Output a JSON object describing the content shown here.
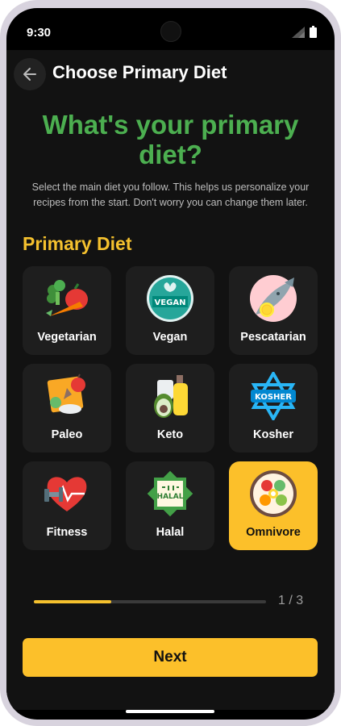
{
  "status_bar": {
    "time": "9:30",
    "icons": [
      "signal-icon",
      "battery-icon"
    ]
  },
  "header": {
    "title": "Choose Primary Diet",
    "back_icon": "arrow-left-icon"
  },
  "question": "What's your primary diet?",
  "subtitle": "Select the main diet you follow. This helps us personalize your recipes from the start. Don't worry you can change them later.",
  "section_title": "Primary Diet",
  "diets": [
    {
      "label": "Vegetarian",
      "icon": "vegetables-icon",
      "selected": false
    },
    {
      "label": "Vegan",
      "icon": "vegan-badge-icon",
      "selected": false
    },
    {
      "label": "Pescatarian",
      "icon": "fish-icon",
      "selected": false
    },
    {
      "label": "Paleo",
      "icon": "paleo-food-icon",
      "selected": false
    },
    {
      "label": "Keto",
      "icon": "avocado-oil-icon",
      "selected": false
    },
    {
      "label": "Kosher",
      "icon": "kosher-star-icon",
      "selected": false
    },
    {
      "label": "Fitness",
      "icon": "heart-dumbbell-icon",
      "selected": false
    },
    {
      "label": "Halal",
      "icon": "halal-badge-icon",
      "selected": false
    },
    {
      "label": "Omnivore",
      "icon": "salad-bowl-icon",
      "selected": true
    }
  ],
  "icon_text": {
    "vegan": "VEGAN",
    "kosher": "KOSHER",
    "halal": "HALAL"
  },
  "progress": {
    "current": 1,
    "total": 3,
    "label": "1 / 3"
  },
  "next_label": "Next",
  "colors": {
    "accent": "#fcc02a",
    "title_green": "#4caf50",
    "background": "#121212",
    "card": "#1e1e1e"
  }
}
